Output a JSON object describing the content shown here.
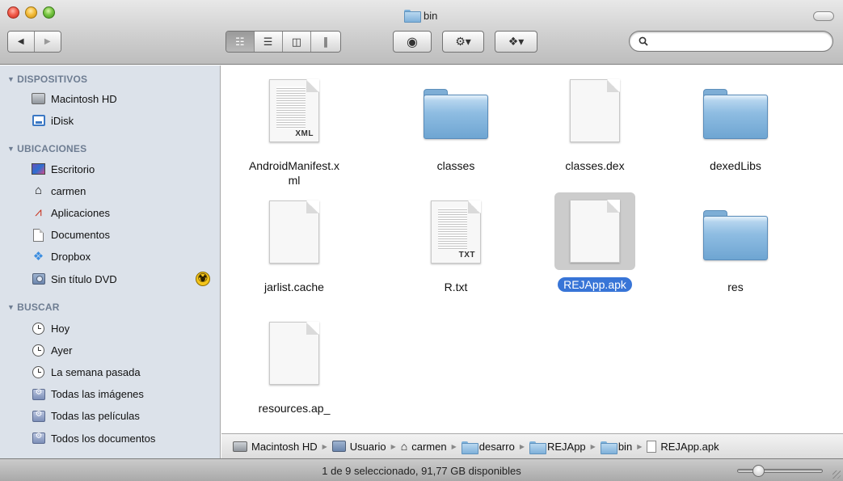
{
  "window": {
    "title": "bin",
    "folder_icon": "folder-icon"
  },
  "toolbar": {
    "back_icon": "back-arrow-icon",
    "forward_icon": "forward-arrow-icon",
    "views": [
      {
        "icon": "icon-view-icon",
        "glyph": "☷",
        "active": true
      },
      {
        "icon": "list-view-icon",
        "glyph": "☰",
        "active": false
      },
      {
        "icon": "column-view-icon",
        "glyph": "◫",
        "active": false
      },
      {
        "icon": "coverflow-view-icon",
        "glyph": "∥",
        "active": false
      }
    ],
    "quicklook_glyph": "◉",
    "action_glyph": "⚙▾",
    "dropbox_glyph": "❖▾",
    "search": {
      "placeholder": "",
      "value": ""
    }
  },
  "sidebar": {
    "sections": [
      {
        "title": "DISPOSITIVOS",
        "items": [
          {
            "label": "Macintosh HD",
            "icon": "hard-disk-icon"
          },
          {
            "label": "iDisk",
            "icon": "idisk-icon"
          }
        ]
      },
      {
        "title": "UBICACIONES",
        "items": [
          {
            "label": "Escritorio",
            "icon": "desktop-icon"
          },
          {
            "label": "carmen",
            "icon": "home-icon"
          },
          {
            "label": "Aplicaciones",
            "icon": "applications-icon"
          },
          {
            "label": "Documentos",
            "icon": "documents-icon"
          },
          {
            "label": "Dropbox",
            "icon": "dropbox-icon"
          },
          {
            "label": "Sin título DVD",
            "icon": "dvd-icon"
          }
        ]
      },
      {
        "title": "BUSCAR",
        "items": [
          {
            "label": "Hoy",
            "icon": "clock-icon"
          },
          {
            "label": "Ayer",
            "icon": "clock-icon"
          },
          {
            "label": "La semana pasada",
            "icon": "clock-icon"
          },
          {
            "label": "Todas las imágenes",
            "icon": "smart-folder-icon"
          },
          {
            "label": "Todas las películas",
            "icon": "smart-folder-icon"
          },
          {
            "label": "Todos los documentos",
            "icon": "smart-folder-icon"
          }
        ]
      }
    ]
  },
  "files": [
    {
      "name": "AndroidManifest.xml",
      "name_line1": "AndroidManifest.x",
      "name_line2": "ml",
      "kind": "document",
      "tag": "XML",
      "selected": false
    },
    {
      "name": "classes",
      "kind": "folder",
      "selected": false
    },
    {
      "name": "classes.dex",
      "kind": "document",
      "tag": "",
      "selected": false
    },
    {
      "name": "dexedLibs",
      "kind": "folder",
      "selected": false
    },
    {
      "name": "jarlist.cache",
      "kind": "document",
      "tag": "",
      "selected": false
    },
    {
      "name": "R.txt",
      "kind": "document",
      "tag": "TXT",
      "selected": false
    },
    {
      "name": "REJApp.apk",
      "kind": "document",
      "tag": "",
      "selected": true
    },
    {
      "name": "res",
      "kind": "folder",
      "selected": false
    },
    {
      "name": "resources.ap_",
      "kind": "document",
      "tag": "",
      "selected": false
    }
  ],
  "pathbar": {
    "crumbs": [
      {
        "label": "Macintosh HD",
        "icon": "hard-disk-icon"
      },
      {
        "label": "Usuario",
        "icon": "users-folder-icon"
      },
      {
        "label": "carmen",
        "icon": "home-icon"
      },
      {
        "label": "desarro",
        "icon": "folder-icon"
      },
      {
        "label": "REJApp",
        "icon": "folder-icon"
      },
      {
        "label": "bin",
        "icon": "folder-icon"
      },
      {
        "label": "REJApp.apk",
        "icon": "document-icon"
      }
    ]
  },
  "status": {
    "text": "1 de 9 seleccionado, 91,77 GB disponibles",
    "zoom_fraction": 0.2
  }
}
